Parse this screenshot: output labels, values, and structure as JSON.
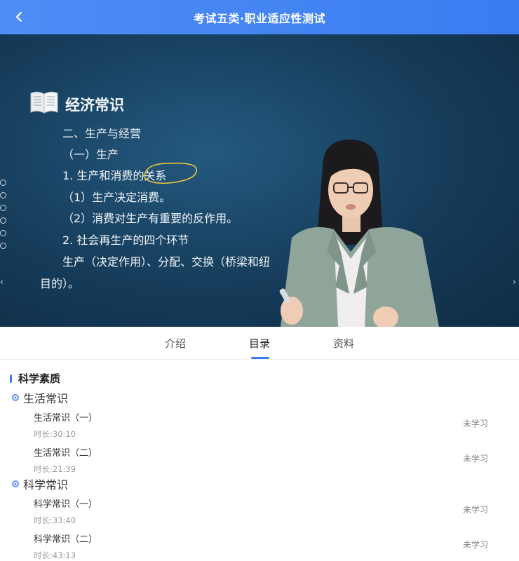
{
  "header": {
    "title": "考试五类·职业适应性测试"
  },
  "slide": {
    "heading": "经济常识",
    "lines": [
      "二、生产与经营",
      "（一）生产",
      "1. 生产和消费的关系",
      "（1）生产决定消费。",
      "（2）消费对生产有重要的反作用。",
      "2. 社会再生产的四个环节",
      "生产（决定作用）、分配、交换（桥梁和纽",
      "目的）。"
    ]
  },
  "tabs": [
    {
      "label": "介绍"
    },
    {
      "label": "目录"
    },
    {
      "label": "资料"
    }
  ],
  "catalog": {
    "section": "科学素质",
    "chapters": [
      {
        "title": "生活常识",
        "lessons": [
          {
            "name": "生活常识（一）",
            "duration": "时长:30:10",
            "status": "未学习"
          },
          {
            "name": "生活常识（二）",
            "duration": "时长:21:39",
            "status": "未学习"
          }
        ]
      },
      {
        "title": "科学常识",
        "lessons": [
          {
            "name": "科学常识（一）",
            "duration": "时长:33:40",
            "status": "未学习"
          },
          {
            "name": "科学常识（二）",
            "duration": "时长:43:13",
            "status": "未学习"
          }
        ]
      }
    ]
  },
  "colors": {
    "accent": "#3a7cf0",
    "header_start": "#4f8ef7"
  },
  "icons": {
    "back": "chevron-left-icon",
    "chapter": "gear-icon",
    "slide": "book-icon"
  }
}
